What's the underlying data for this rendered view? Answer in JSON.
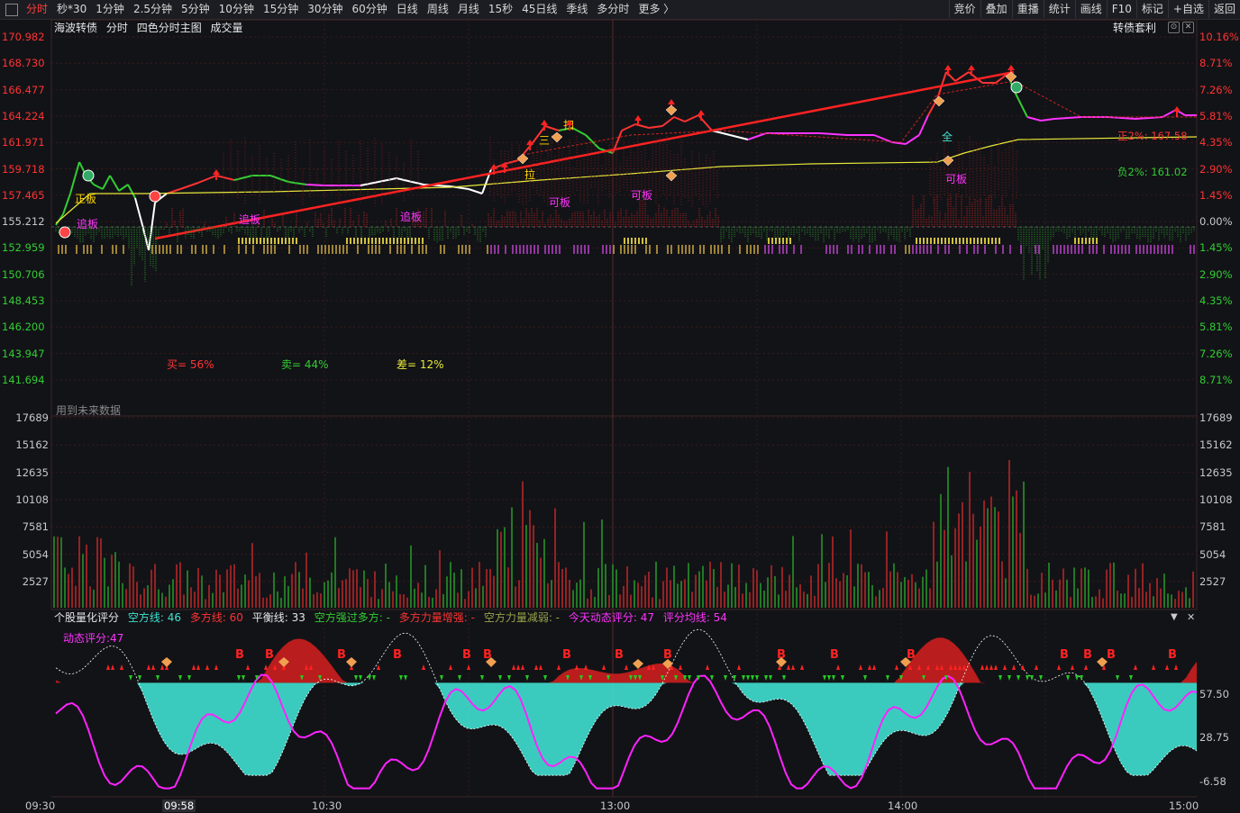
{
  "toolbar": {
    "tabs": [
      "分时",
      "秒*30",
      "1分钟",
      "2.5分钟",
      "5分钟",
      "10分钟",
      "15分钟",
      "30分钟",
      "60分钟",
      "日线",
      "周线",
      "月线",
      "15秒",
      "45日线",
      "季线",
      "多分时",
      "更多 〉"
    ],
    "active_tab": "分时",
    "right_buttons": [
      "竞价",
      "叠加",
      "重播",
      "统计",
      "画线",
      "F10",
      "标记",
      "+自选",
      "返回"
    ]
  },
  "chart_header": {
    "title": "海波转债",
    "mode": "分时",
    "main_chart": "四色分时主图",
    "volume": "成交量",
    "arbitrage_button": "转债套利"
  },
  "price_axis": {
    "prices": [
      "170.982",
      "168.730",
      "166.477",
      "164.224",
      "161.971",
      "159.718",
      "157.465",
      "155.212",
      "152.959",
      "150.706",
      "148.453",
      "146.200",
      "143.947",
      "141.694"
    ],
    "percents": [
      "10.16%",
      "8.71%",
      "7.26%",
      "5.81%",
      "4.35%",
      "2.90%",
      "1.45%",
      "0.00%",
      "1.45%",
      "2.90%",
      "4.35%",
      "5.81%",
      "7.26%",
      "8.71%"
    ]
  },
  "annotations": {
    "pos2": "正2%: 167.58",
    "neg2": "负2%: 161.02",
    "buy": "买= 56%",
    "sell": "卖= 44%",
    "diff": "差= 12%",
    "future_data": "用到未来数据",
    "labels": [
      "追板",
      "追板",
      "追板",
      "可板",
      "可板",
      "可板",
      "拉",
      "三",
      "扫",
      "全",
      "正板"
    ]
  },
  "volume_axis": [
    "17689",
    "15162",
    "12635",
    "10108",
    "7581",
    "5054",
    "2527"
  ],
  "indicator": {
    "name": "个股量化评分",
    "empty_line": "空方线: 46",
    "long_line": "多方线: 60",
    "balance": "平衡线: 33",
    "empty_strong": "空方强过多方: -",
    "long_increase": "多方力量增强: -",
    "empty_decrease": "空方力量减弱: -",
    "today_score": "今天动态评分: 47",
    "avg_line": "评分均线: 54",
    "dynamic": "动态评分:47",
    "axis": [
      "57.50",
      "28.75",
      "-6.58"
    ]
  },
  "time_axis": [
    "09:30",
    "09:58",
    "10:30",
    "13:00",
    "14:00",
    "15:00"
  ],
  "colors": {
    "up": "#ff3333",
    "down": "#33cc33",
    "avg": "#e8e83a",
    "magenta": "#ff33ff",
    "cyan": "#40e0d0",
    "grid": "#3a1a1a"
  }
}
